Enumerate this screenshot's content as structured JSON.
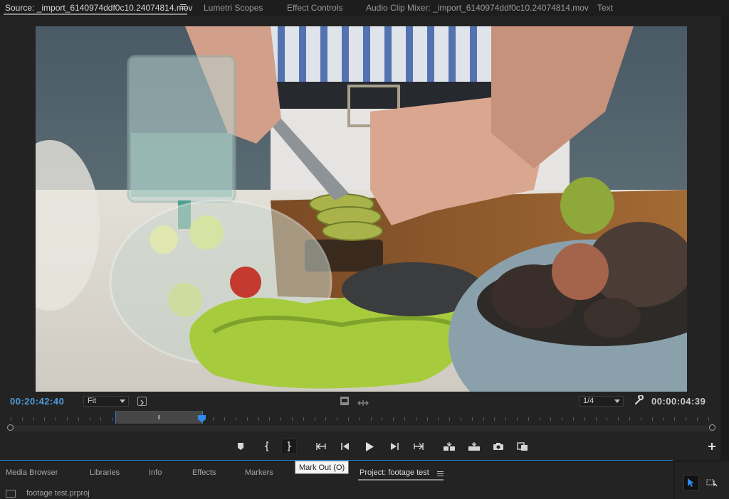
{
  "tabs": [
    {
      "label": "Source: _import_6140974ddf0c10.24074814.mov",
      "active": true
    },
    {
      "label": "Lumetri Scopes",
      "active": false
    },
    {
      "label": "Effect Controls",
      "active": false
    },
    {
      "label": "Audio Clip Mixer: _import_6140974ddf0c10.24074814.mov",
      "active": false
    },
    {
      "label": "Text",
      "active": false
    }
  ],
  "monitor": {
    "current_timecode": "00:20:42:40",
    "zoom_select": "Fit",
    "resolution_select": "1/4",
    "duration_timecode": "00:00:04:39",
    "colors": {
      "accent": "#2d8ceb",
      "timecode": "#4f9bde"
    }
  },
  "transport": {
    "buttons": [
      {
        "name": "add-marker-button",
        "icon": "marker-icon"
      },
      {
        "name": "mark-in-button",
        "icon": "mark-in-icon"
      },
      {
        "name": "mark-out-button",
        "icon": "mark-out-icon"
      },
      {
        "name": "go-to-in-button",
        "icon": "go-to-in-icon"
      },
      {
        "name": "step-back-button",
        "icon": "step-back-icon"
      },
      {
        "name": "play-button",
        "icon": "play-icon"
      },
      {
        "name": "step-forward-button",
        "icon": "step-forward-icon"
      },
      {
        "name": "go-to-out-button",
        "icon": "go-to-out-icon"
      },
      {
        "name": "insert-button",
        "icon": "insert-icon"
      },
      {
        "name": "overwrite-button",
        "icon": "overwrite-icon"
      },
      {
        "name": "export-frame-button",
        "icon": "camera-icon"
      },
      {
        "name": "button-editor-button",
        "icon": "button-editor-icon"
      }
    ],
    "tooltip": "Mark Out (O)"
  },
  "bottom_tabs": [
    {
      "label": "Media Browser",
      "active": false
    },
    {
      "label": "Libraries",
      "active": false
    },
    {
      "label": "Info",
      "active": false
    },
    {
      "label": "Effects",
      "active": false
    },
    {
      "label": "Markers",
      "active": false
    },
    {
      "label": "Project: footage test",
      "active": true
    }
  ],
  "project": {
    "file": "footage test.prproj"
  }
}
